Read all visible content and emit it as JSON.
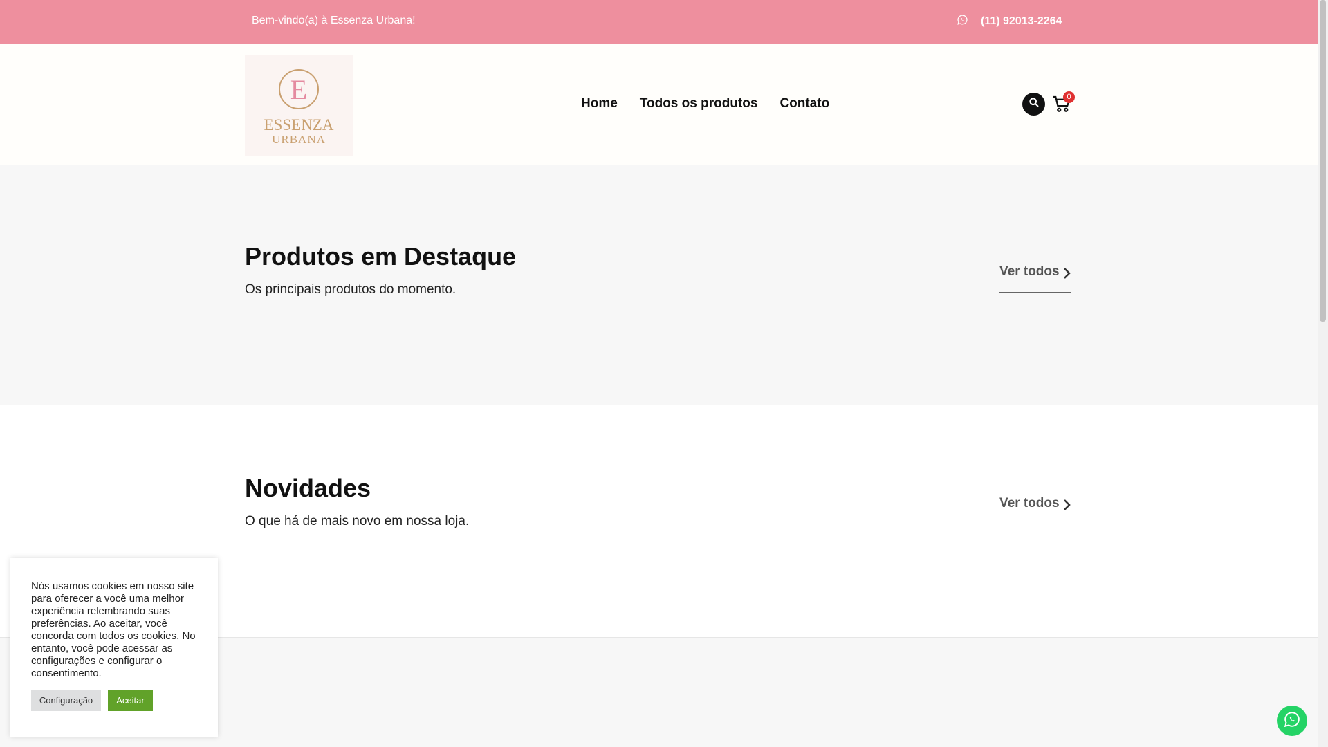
{
  "topbar": {
    "welcome": "Bem-vindo(a) à Essenza Urbana!",
    "phone": "(11) 92013-2264",
    "icon": "whatsapp-icon",
    "bg_color": "#ee8f9e"
  },
  "header": {
    "logo": {
      "letter": "E",
      "line1": "ESSENZA",
      "line2": "URBANA"
    },
    "nav": [
      "Home",
      "Todos os produtos",
      "Contato"
    ],
    "cart_count": "0",
    "icons": [
      "search-icon",
      "cart-icon"
    ]
  },
  "sections": {
    "featured": {
      "title": "Produtos em Destaque",
      "subtitle": "Os principais produtos do momento.",
      "view_all": "Ver todos"
    },
    "new": {
      "title": "Novidades",
      "subtitle": "O que há de mais novo em nossa loja.",
      "view_all": "Ver todos"
    }
  },
  "cookie": {
    "text": "Nós usamos cookies em nosso site para oferecer a você uma melhor experiência relembrando suas preferências. Ao aceitar, você concorda com todos os cookies. No entanto, você pode acessar as configurações e configurar o consentimento.",
    "config_label": "Configuração",
    "accept_label": "Aceitar",
    "accept_color": "#61a229"
  },
  "floating": {
    "icon": "whatsapp-icon",
    "color": "#25d366"
  }
}
